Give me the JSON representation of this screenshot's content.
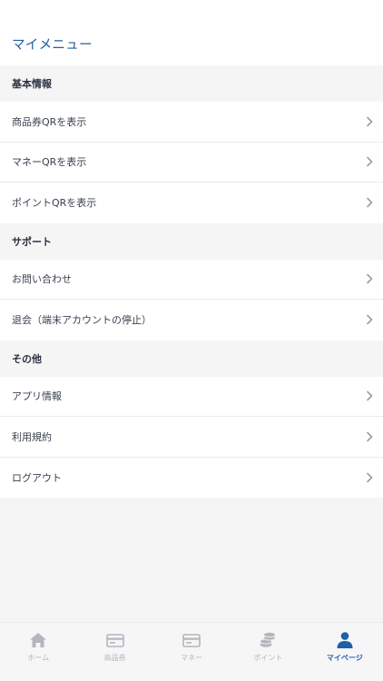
{
  "header": {
    "title": "マイメニュー"
  },
  "sections": [
    {
      "title": "基本情報",
      "items": [
        {
          "label": "商品券QRを表示"
        },
        {
          "label": "マネーQRを表示"
        },
        {
          "label": "ポイントQRを表示"
        }
      ]
    },
    {
      "title": "サポート",
      "items": [
        {
          "label": "お問い合わせ"
        },
        {
          "label": "退会（端末アカウントの停止）"
        }
      ]
    },
    {
      "title": "その他",
      "items": [
        {
          "label": "アプリ情報"
        },
        {
          "label": "利用規約"
        },
        {
          "label": "ログアウト"
        }
      ]
    }
  ],
  "tabbar": {
    "tabs": [
      {
        "label": "ホーム",
        "icon": "home-icon"
      },
      {
        "label": "商品券",
        "icon": "voucher-card-icon"
      },
      {
        "label": "マネー",
        "icon": "money-card-icon"
      },
      {
        "label": "ポイント",
        "icon": "coins-icon"
      },
      {
        "label": "マイページ",
        "icon": "user-icon",
        "active": true
      }
    ],
    "active_color": "#1f5fa6",
    "inactive_color": "#b3b6bd"
  },
  "colors": {
    "accent": "#1f5fa6",
    "background": "#f5f5f6"
  }
}
